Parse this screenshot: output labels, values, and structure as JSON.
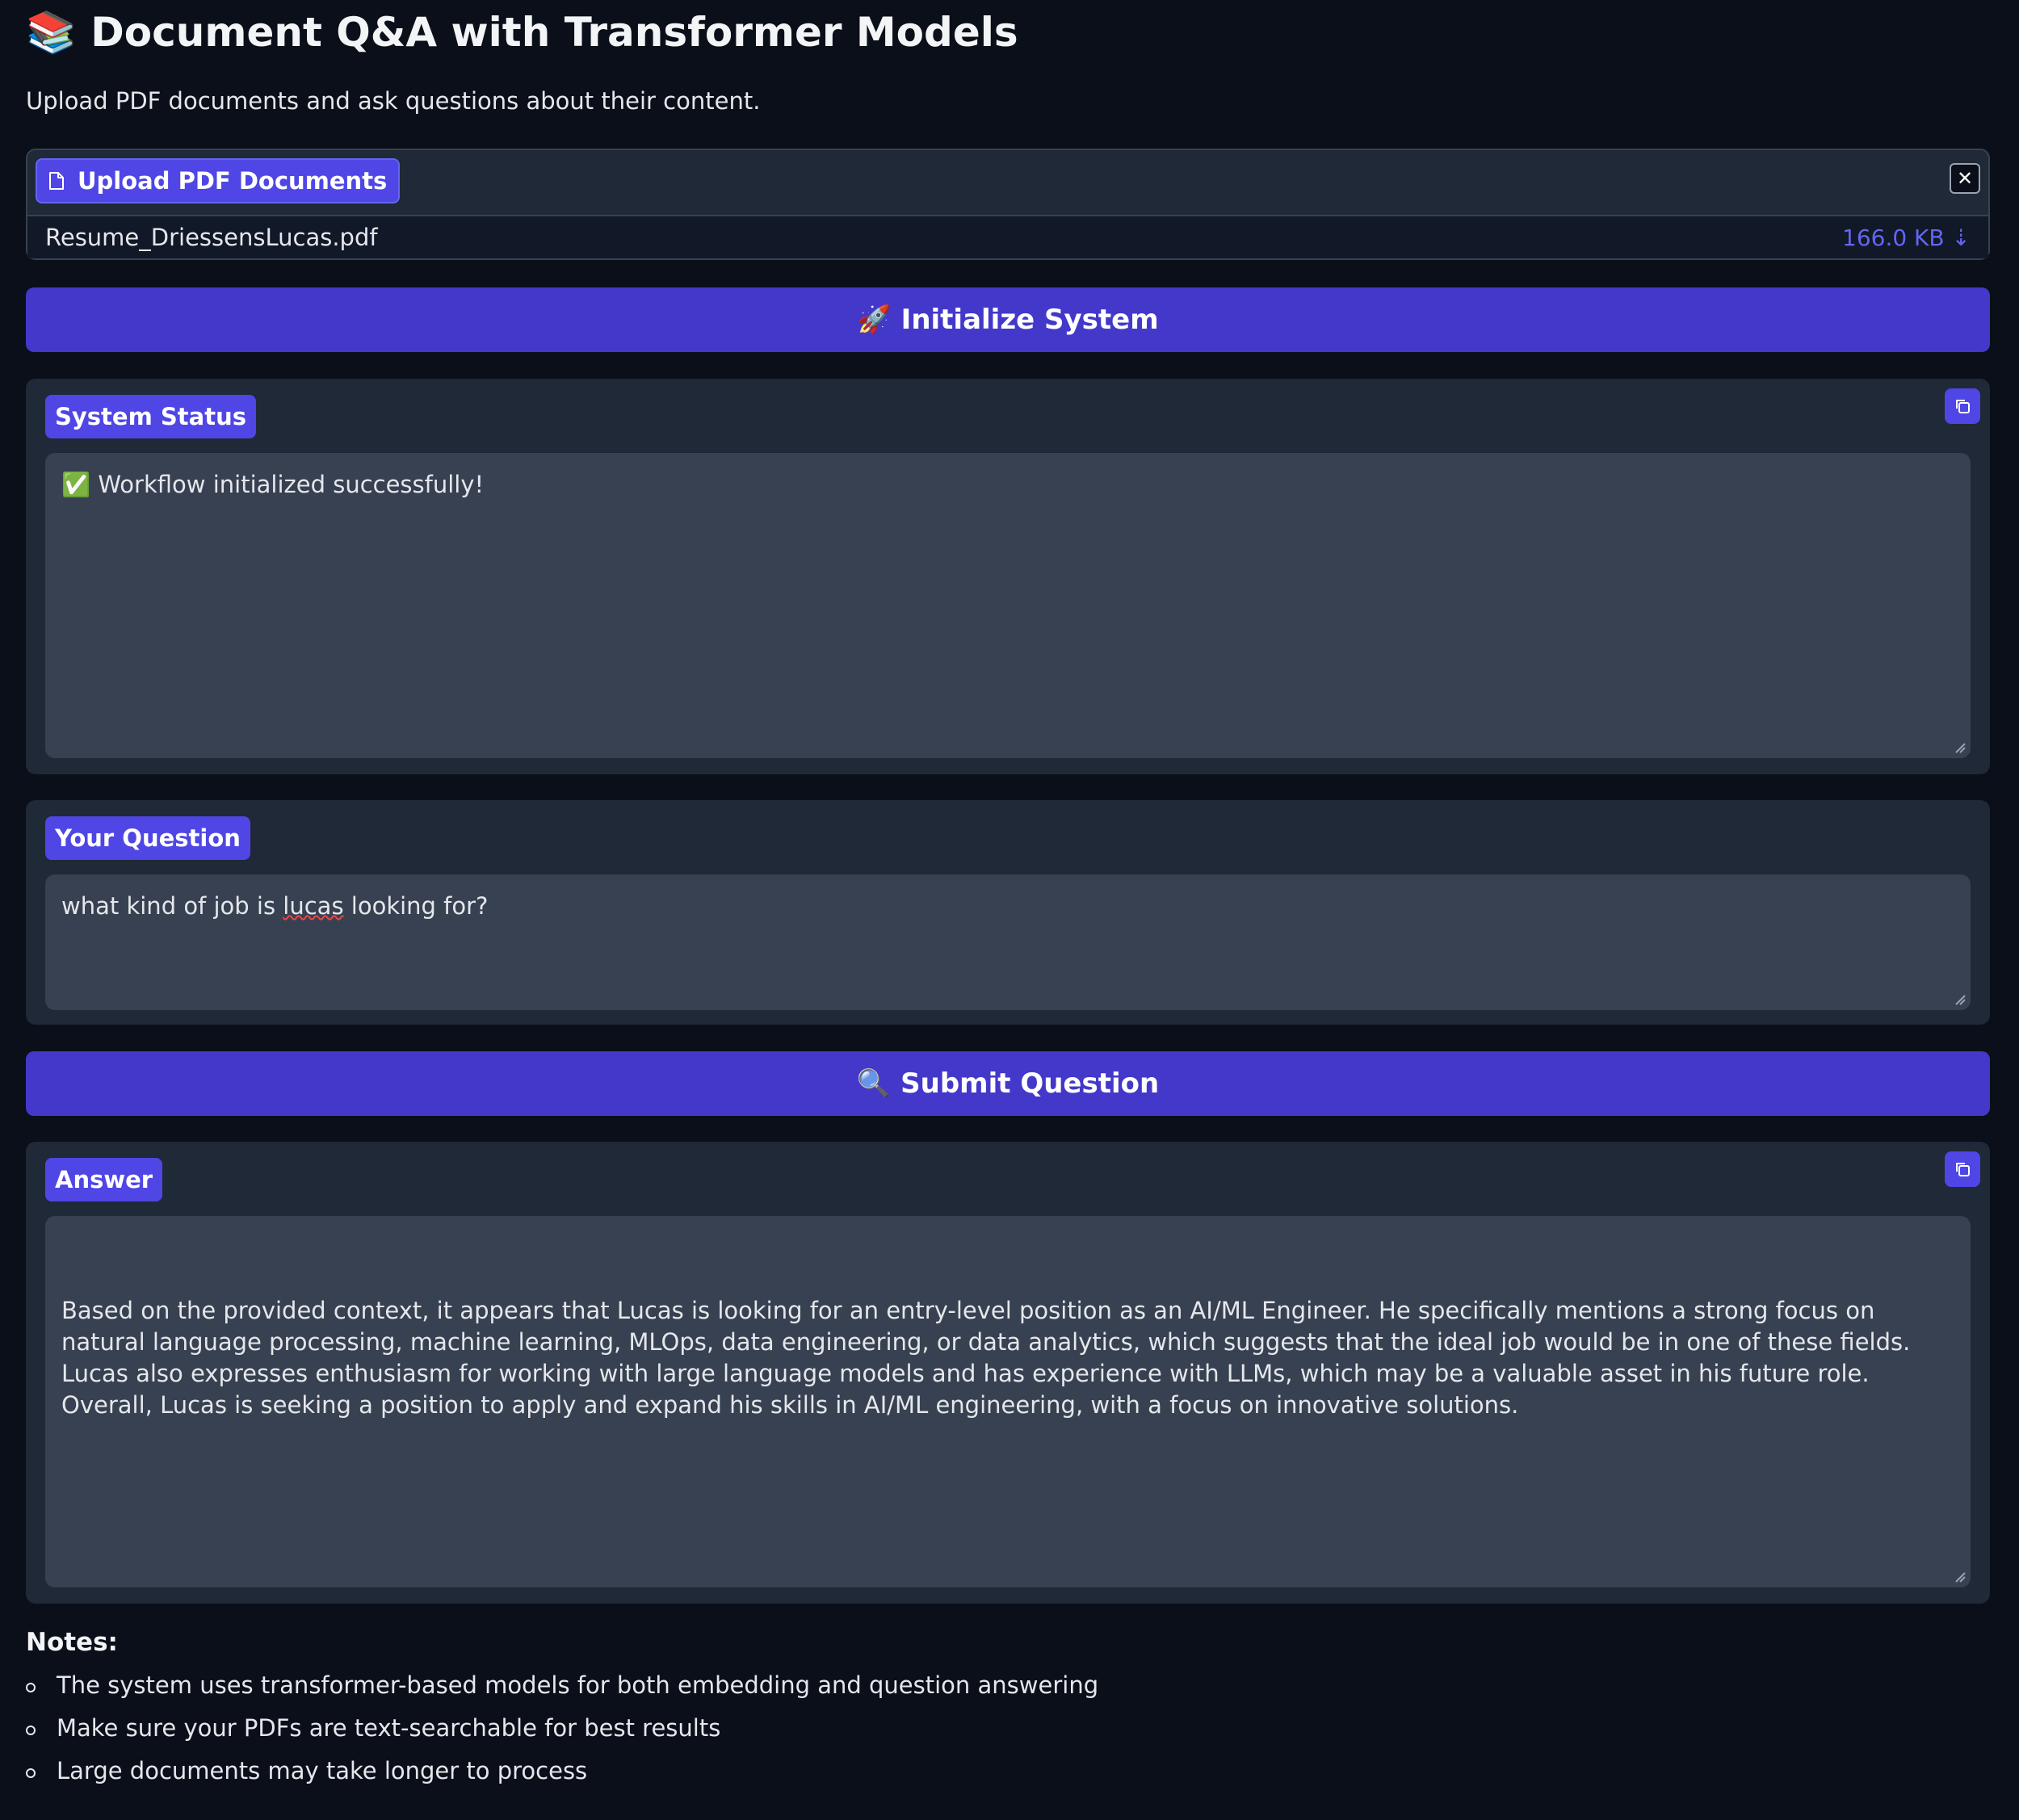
{
  "header": {
    "title_emoji": "📚",
    "title": "Document Q&A with Transformer Models",
    "subtitle": "Upload PDF documents and ask questions about their content."
  },
  "upload": {
    "label": "Upload PDF Documents",
    "file_name": "Resume_DriessensLucas.pdf",
    "file_size": "166.0 KB ⇣",
    "clear_icon": "close-icon",
    "file_icon": "file-icon"
  },
  "init_button": {
    "emoji": "🚀",
    "label": "Initialize System"
  },
  "status": {
    "label": "System Status",
    "value": "✅ Workflow initialized successfully!"
  },
  "question": {
    "label": "Your Question",
    "value_before": "what kind of job is ",
    "value_misspelled": "lucas",
    "value_after": " looking for?"
  },
  "submit_button": {
    "emoji": "🔍",
    "label": "Submit Question"
  },
  "answer": {
    "label": "Answer",
    "value": "Based on the provided context, it appears that Lucas is looking for an entry-level position as an AI/ML Engineer. He specifically mentions a strong focus on natural language processing, machine learning, MLOps, data engineering, or data analytics, which suggests that the ideal job would be in one of these fields. Lucas also expresses enthusiasm for working with large language models and has experience with LLMs, which may be a valuable asset in his future role. Overall, Lucas is seeking a position to apply and expand his skills in AI/ML engineering, with a focus on innovative solutions."
  },
  "notes": {
    "title": "Notes:",
    "items": [
      "The system uses transformer-based models for both embedding and question answering",
      "Make sure your PDFs are text-searchable for best results",
      "Large documents may take longer to process"
    ]
  },
  "colors": {
    "background": "#0b0f19",
    "panel": "#1f2937",
    "input": "#374151",
    "accent": "#4f46e5",
    "button": "#4338ca"
  }
}
